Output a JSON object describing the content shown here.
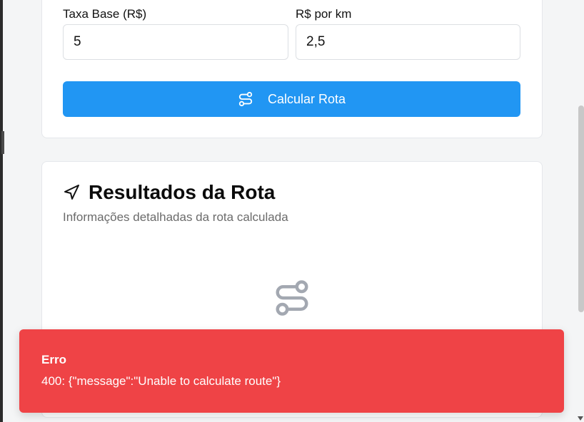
{
  "form": {
    "base_fee_label": "Taxa Base (R$)",
    "base_fee_value": "5",
    "per_km_label": "R$ por km",
    "per_km_value": "2,5",
    "calculate_button_label": "Calcular Rota"
  },
  "results": {
    "title": "Resultados da Rota",
    "subtitle": "Informações detalhadas da rota calculada",
    "empty_icon": "route-icon"
  },
  "toast": {
    "title": "Erro",
    "message": "400: {\"message\":\"Unable to calculate route\"}",
    "color": "#ef4346"
  },
  "colors": {
    "primary": "#2196f3",
    "error": "#ef4346"
  }
}
